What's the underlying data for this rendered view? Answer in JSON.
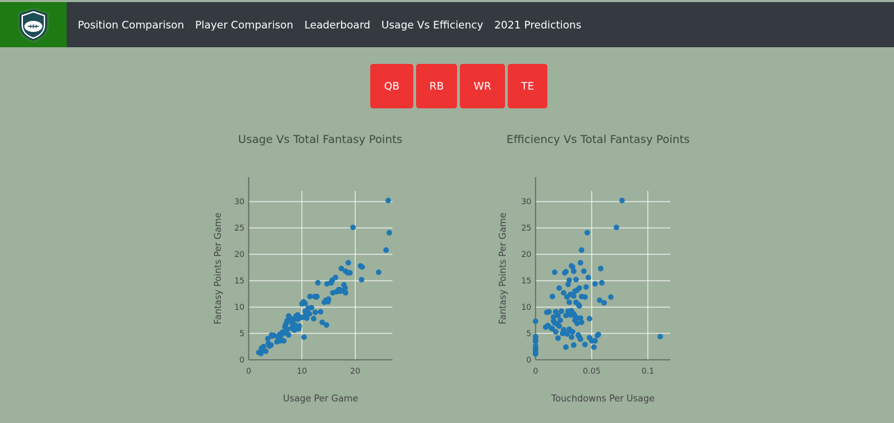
{
  "nav": {
    "links": [
      "Position Comparison",
      "Player Comparison",
      "Leaderboard",
      "Usage Vs Efficiency",
      "2021 Predictions"
    ]
  },
  "position_buttons": [
    "QB",
    "RB",
    "WR",
    "TE"
  ],
  "colors": {
    "background": "#9db19d",
    "navbar": "#343a40",
    "logo_bg": "#1e7a12",
    "button": "#ee3333",
    "marker": "#1f77b4"
  },
  "chart_data": [
    {
      "type": "scatter",
      "title": "Usage Vs Total Fantasy Points",
      "xlabel": "Usage Per Game",
      "ylabel": "Fantasy Points Per Game",
      "xlim": [
        0,
        27
      ],
      "ylim": [
        0,
        32
      ],
      "xticks": [
        0,
        10,
        20
      ],
      "yticks": [
        0,
        5,
        10,
        15,
        20,
        25,
        30
      ],
      "grid": true,
      "x": [
        26.2,
        19.6,
        26.4,
        25.8,
        24.4,
        21.3,
        21.0,
        21.2,
        18.7,
        17.4,
        18.2,
        18.6,
        19.0,
        17.9,
        18.1,
        16.3,
        15.7,
        15.5,
        16.9,
        15.8,
        17.2,
        18.2,
        14.7,
        15.0,
        12.8,
        14.2,
        14.5,
        14.9,
        12.4,
        12.7,
        13.5,
        11.5,
        10.3,
        10.6,
        10.0,
        11.2,
        11.8,
        10.6,
        12.5,
        11.0,
        11.4,
        12.2,
        10.7,
        9.8,
        9.2,
        8.9,
        10.3,
        10.9,
        8.6,
        7.5,
        7.8,
        9.2,
        8.1,
        7.2,
        7.0,
        8.7,
        6.8,
        8.1,
        6.9,
        9.4,
        8.6,
        7.1,
        6.9,
        5.8,
        7.5,
        6.3,
        4.3,
        4.8,
        5.5,
        6.0,
        6.3,
        7.3,
        5.9,
        6.6,
        5.3,
        3.6,
        4.4,
        2.8,
        3.7,
        4.2,
        2.4,
        2.1,
        3.2,
        3.9,
        2.6,
        1.9,
        2.3,
        13.0,
        9.5,
        10.4,
        14.6,
        13.8,
        15.4,
        18.0,
        16.5,
        17.1
      ],
      "y": [
        30.2,
        25.1,
        24.1,
        20.8,
        16.6,
        17.6,
        17.8,
        15.2,
        18.4,
        17.3,
        16.8,
        16.5,
        16.5,
        14.2,
        13.6,
        15.6,
        15.1,
        14.6,
        13.3,
        12.7,
        13.0,
        12.7,
        14.4,
        11.5,
        12.0,
        10.9,
        11.3,
        11.0,
        12.0,
        11.9,
        9.1,
        12.0,
        11.0,
        10.7,
        10.6,
        9.8,
        9.9,
        9.2,
        9.0,
        9.3,
        8.7,
        7.8,
        8.4,
        8.0,
        8.5,
        8.3,
        8.1,
        7.9,
        7.7,
        8.3,
        7.9,
        7.7,
        7.0,
        7.4,
        6.8,
        6.6,
        6.3,
        6.0,
        5.7,
        5.9,
        5.6,
        5.3,
        5.1,
        4.8,
        4.7,
        5.2,
        4.7,
        4.6,
        4.3,
        4.5,
        4.9,
        5.8,
        3.6,
        3.6,
        3.4,
        4.0,
        4.5,
        2.5,
        3.1,
        2.8,
        2.2,
        1.4,
        1.6,
        2.6,
        1.9,
        1.4,
        1.2,
        14.6,
        6.4,
        4.3,
        6.6,
        7.1,
        14.6,
        13.0,
        12.9,
        13.3
      ]
    },
    {
      "type": "scatter",
      "title": "Efficiency Vs Total Fantasy Points",
      "xlabel": "Touchdowns Per Usage",
      "ylabel": "Fantasy Points Per Game",
      "xlim": [
        0,
        0.12
      ],
      "ylim": [
        0,
        32
      ],
      "xticks": [
        0,
        0.05,
        0.1
      ],
      "xtick_labels": [
        "0",
        "0.05",
        "0.1"
      ],
      "yticks": [
        0,
        5,
        10,
        15,
        20,
        25,
        30
      ],
      "grid": true,
      "x": [
        0.077,
        0.072,
        0.046,
        0.041,
        0.033,
        0.032,
        0.034,
        0.058,
        0.04,
        0.047,
        0.017,
        0.026,
        0.027,
        0.03,
        0.036,
        0.043,
        0.059,
        0.045,
        0.053,
        0.037,
        0.029,
        0.039,
        0.021,
        0.025,
        0.031,
        0.035,
        0.034,
        0.028,
        0.041,
        0.015,
        0.023,
        0.038,
        0.03,
        0.036,
        0.039,
        0.044,
        0.057,
        0.061,
        0.067,
        0.032,
        0.029,
        0.031,
        0.034,
        0.01,
        0.012,
        0.018,
        0.02,
        0.016,
        0.022,
        0.027,
        0.035,
        0.037,
        0.04,
        0.048,
        0.035,
        0.037,
        0.041,
        0.016,
        0.017,
        0.019,
        0.021,
        0.014,
        0.025,
        0.03,
        0.033,
        0.026,
        0.031,
        0.009,
        0.011,
        0.015,
        0.018,
        0.024,
        0.028,
        0.02,
        0.032,
        0.038,
        0.039,
        0.04,
        0.048,
        0.05,
        0.055,
        0.056,
        0.053,
        0.052,
        0.044,
        0.034,
        0.027,
        0.0,
        0.0,
        0.0,
        0.0,
        0.0,
        0.0,
        0.0,
        0.0,
        0.0,
        0.111
      ],
      "y": [
        30.2,
        25.1,
        24.1,
        20.8,
        17.6,
        17.8,
        16.8,
        17.3,
        18.4,
        15.6,
        16.6,
        16.5,
        16.7,
        15.1,
        15.2,
        16.8,
        14.6,
        13.8,
        14.4,
        13.2,
        14.3,
        13.6,
        13.6,
        12.7,
        12.4,
        13.0,
        12.1,
        11.9,
        12.0,
        12.0,
        9.2,
        10.5,
        10.9,
        10.9,
        10.2,
        11.9,
        11.3,
        10.8,
        11.9,
        9.3,
        9.2,
        8.5,
        8.7,
        9.0,
        9.1,
        9.1,
        8.4,
        8.1,
        7.5,
        8.4,
        8.3,
        7.9,
        7.9,
        7.8,
        7.5,
        6.9,
        7.1,
        7.4,
        7.0,
        6.8,
        6.4,
        6.0,
        5.7,
        5.8,
        5.3,
        5.1,
        5.5,
        6.2,
        6.5,
        5.9,
        5.3,
        5.0,
        4.9,
        4.1,
        4.3,
        4.7,
        4.3,
        3.9,
        4.2,
        3.6,
        4.6,
        4.8,
        3.6,
        2.4,
        2.9,
        2.8,
        2.4,
        7.3,
        4.4,
        3.8,
        3.5,
        2.6,
        2.2,
        1.8,
        1.4,
        1.1,
        4.4
      ]
    }
  ]
}
